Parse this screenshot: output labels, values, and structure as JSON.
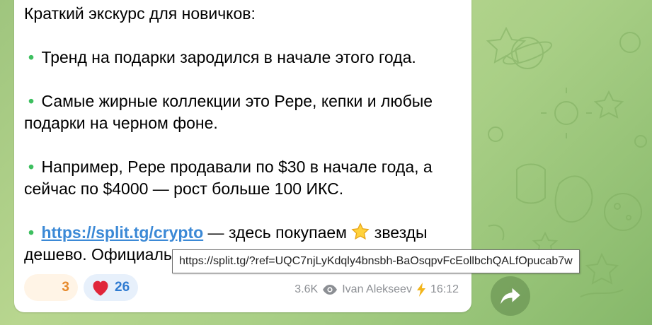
{
  "message": {
    "intro": "Краткий экскурс для новичков:",
    "bullet_glyph": "•",
    "bullet1": "Тренд на подарки зародился в начале этого года.",
    "bullet2": "Самые жирные коллекции это Pepe, кепки и любые подарки на черном фоне.",
    "bullet3": "Например, Pepe продавали по $30 в начале года, а сейчас по $4000 — рост больше 100 ИКС.",
    "bullet4_link": "https://split.tg/crypto",
    "bullet4_text_a": " — здесь покупаем ",
    "bullet4_text_b": " звезды дешево. Официаль",
    "star_icon": "star-emoji"
  },
  "reactions": [
    {
      "emoji": "",
      "count": "3"
    },
    {
      "emoji": "heart-icon",
      "count": "26"
    }
  ],
  "meta": {
    "views": "3.6K",
    "author": "Ivan Alekseev",
    "time": "16:12"
  },
  "tooltip": {
    "url": "https://split.tg/?ref=UQC7njLyKdqly4bnsbh-BaOsqpvFcEollbchQALfOpucab7w"
  },
  "colors": {
    "accent_link": "#3b89d6",
    "bullet": "#3dbf5f",
    "background": "#a9cf86",
    "heart": "#e0263a",
    "lightning": "#f2b51c"
  }
}
